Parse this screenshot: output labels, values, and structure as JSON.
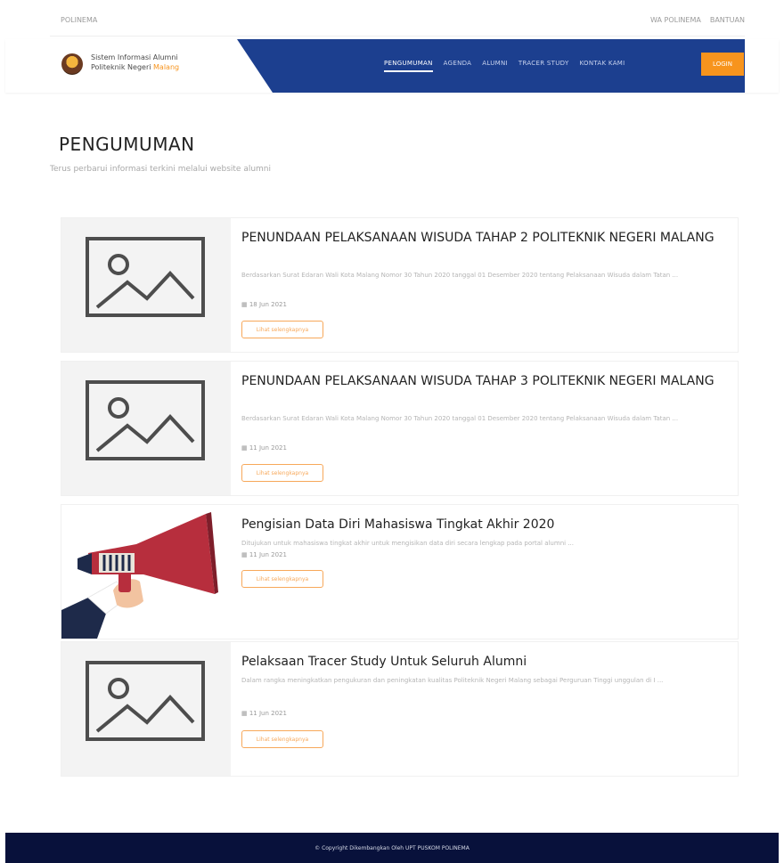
{
  "topbar": {
    "brand": "POLINEMA",
    "links": [
      "WA POLINEMA",
      "BANTUAN"
    ]
  },
  "header": {
    "site_line1": "Sistem Informasi Alumni",
    "site_line2": "Politeknik Negeri",
    "site_highlight": "Malang",
    "menu": [
      "PENGUMUMAN",
      "AGENDA",
      "ALUMNI",
      "TRACER STUDY",
      "KONTAK KAMI"
    ],
    "active_menu": "PENGUMUMAN",
    "login_label": "LOGIN"
  },
  "page": {
    "title": "PENGUMUMAN",
    "subtitle": "Terus perbarui informasi terkini melalui website alumni"
  },
  "announcements": [
    {
      "title": "PENUNDAAN PELAKSANAAN WISUDA TAHAP 2 POLITEKNIK NEGERI MALANG",
      "description": "Berdasarkan Surat Edaran Wali Kota Malang Nomor 30 Tahun 2020 tanggal 01 Desember 2020 tentang Pelaksanaan Wisuda dalam Tatan ...",
      "date": "18 Jun 2021",
      "button": "Lihat selengkapnya",
      "image": "placeholder"
    },
    {
      "title": "PENUNDAAN PELAKSANAAN WISUDA TAHAP 3 POLITEKNIK NEGERI MALANG",
      "description": "Berdasarkan Surat Edaran Wali Kota Malang Nomor 30 Tahun 2020 tanggal 01 Desember 2020 tentang Pelaksanaan Wisuda dalam Tatan ...",
      "date": "11 Jun 2021",
      "button": "Lihat selengkapnya",
      "image": "placeholder"
    },
    {
      "title": "Pengisian Data Diri Mahasiswa Tingkat Akhir 2020",
      "description": "Ditujukan untuk mahasiswa tingkat akhir untuk mengisikan data diri secara lengkap pada portal alumni ...",
      "date": "11 Jun 2021",
      "button": "Lihat selengkapnya",
      "image": "megaphone"
    },
    {
      "title": "Pelaksaan Tracer Study Untuk Seluruh Alumni",
      "description": "Dalam rangka meningkatkan pengukuran dan peningkatan kualitas Politeknik Negeri Malang sebagai Perguruan Tinggi unggulan di I ...",
      "date": "11 Jun 2021",
      "button": "Lihat selengkapnya",
      "image": "placeholder"
    }
  ],
  "footer": {
    "text": "© Copyright Dikembangkan Oleh UPT PUSKOM POLINEMA"
  },
  "colors": {
    "nav_blue": "#1c3f8f",
    "accent_orange": "#f7941d",
    "footer_navy": "#08113b"
  },
  "icons": {
    "image_placeholder": "image-placeholder-icon",
    "megaphone": "megaphone-illustration",
    "calendar": "calendar-icon"
  }
}
